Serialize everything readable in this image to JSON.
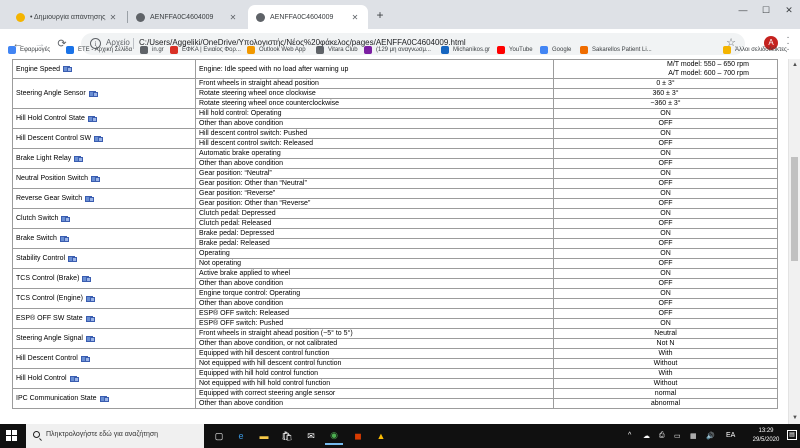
{
  "browser": {
    "tabs": [
      {
        "title": "• Δημιουργία απάντησης",
        "favicon_color": "#f4b400",
        "active": false
      },
      {
        "title": "AENFFA0C4604009",
        "favicon_color": "#5f6368",
        "active": false
      },
      {
        "title": "AENFFA0C4604009",
        "favicon_color": "#5f6368",
        "active": true
      }
    ],
    "new_tab_glyph": "+",
    "window_controls": {
      "minimize": "—",
      "maximize": "☐",
      "close": "✕"
    },
    "nav": {
      "back": "←",
      "forward": "→",
      "reload": "⟳"
    },
    "omnibox": {
      "scheme_label": "Αρχείο",
      "url": "C:/Users/Aggeliki/OneDrive/Υπολογιστής/Νέος%20φάκελος/pages/AENFFA0C4604009.html"
    },
    "profile_initial": "A",
    "bookmarks": [
      {
        "label": "Εφαρμογές",
        "icon_color": "#4285f4"
      },
      {
        "label": "ΕΤΕ - Αρχική Σελίδα",
        "icon_color": "#1a73e8"
      },
      {
        "label": "in.gr",
        "icon_color": "#5f6368"
      },
      {
        "label": "ΕΦΚΑ | Ενιαίος Φορ...",
        "icon_color": "#d93025"
      },
      {
        "label": "Outlook Web App",
        "icon_color": "#f29900"
      },
      {
        "label": "Vitara Club",
        "icon_color": "#5f6368"
      },
      {
        "label": "(129 μη αναγνωσμ...",
        "icon_color": "#7b1fa2"
      },
      {
        "label": "Michanikos.gr",
        "icon_color": "#1565c0"
      },
      {
        "label": "YouTube",
        "icon_color": "#ff0000"
      },
      {
        "label": "Google",
        "icon_color": "#4285f4"
      },
      {
        "label": "Sakarellos Patient Li...",
        "icon_color": "#ef6c00"
      }
    ],
    "other_bookmarks": "Άλλοι σελιδοδείκτες"
  },
  "spec_table": [
    {
      "item": "Engine Speed",
      "conditions": [
        {
          "condition": "Engine: Idle speed with no load after warning up",
          "value": "M/T model: 550 – 650 rpm\nA/T model: 600 – 700 rpm"
        }
      ]
    },
    {
      "item": "Steering Angle Sensor",
      "conditions": [
        {
          "condition": "Front wheels in straight ahead position",
          "value": "0 ± 3°"
        },
        {
          "condition": "Rotate steering wheel once clockwise",
          "value": "360 ± 3°"
        },
        {
          "condition": "Rotate steering wheel once counterclockwise",
          "value": "−360 ± 3°"
        }
      ]
    },
    {
      "item": "Hill Hold Control State",
      "conditions": [
        {
          "condition": "Hill hold control: Operating",
          "value": "ON"
        },
        {
          "condition": "Other than above condition",
          "value": "OFF"
        }
      ]
    },
    {
      "item": "Hill Descent Control SW",
      "conditions": [
        {
          "condition": "Hill descent control switch: Pushed",
          "value": "ON"
        },
        {
          "condition": "Hill descent control switch: Released",
          "value": "OFF"
        }
      ]
    },
    {
      "item": "Brake Light Relay",
      "conditions": [
        {
          "condition": "Automatic brake operating",
          "value": "ON"
        },
        {
          "condition": "Other than above condition",
          "value": "OFF"
        }
      ]
    },
    {
      "item": "Neutral Position Switch",
      "conditions": [
        {
          "condition": "Gear position: “Neutral”",
          "value": "ON"
        },
        {
          "condition": "Gear position: Other than “Neutral”",
          "value": "OFF"
        }
      ]
    },
    {
      "item": "Reverse Gear Switch",
      "conditions": [
        {
          "condition": "Gear position: “Reverse”",
          "value": "ON"
        },
        {
          "condition": "Gear position: Other than “Reverse”",
          "value": "OFF"
        }
      ]
    },
    {
      "item": "Clutch Switch",
      "conditions": [
        {
          "condition": "Clutch pedal: Depressed",
          "value": "ON"
        },
        {
          "condition": "Clutch pedal: Released",
          "value": "OFF"
        }
      ]
    },
    {
      "item": "Brake Switch",
      "conditions": [
        {
          "condition": "Brake pedal: Depressed",
          "value": "ON"
        },
        {
          "condition": "Brake pedal: Released",
          "value": "OFF"
        }
      ]
    },
    {
      "item": "Stability Control",
      "conditions": [
        {
          "condition": "Operating",
          "value": "ON"
        },
        {
          "condition": "Not operating",
          "value": "OFF"
        }
      ]
    },
    {
      "item": "TCS Control (Brake)",
      "conditions": [
        {
          "condition": "Active brake applied to wheel",
          "value": "ON"
        },
        {
          "condition": "Other than above condition",
          "value": "OFF"
        }
      ]
    },
    {
      "item": "TCS Control (Engine)",
      "conditions": [
        {
          "condition": "Engine torque control: Operating",
          "value": "ON"
        },
        {
          "condition": "Other than above condition",
          "value": "OFF"
        }
      ]
    },
    {
      "item": "ESP® OFF SW State",
      "conditions": [
        {
          "condition": "ESP® OFF switch: Released",
          "value": "OFF"
        },
        {
          "condition": "ESP® OFF switch: Pushed",
          "value": "ON"
        }
      ]
    },
    {
      "item": "Steering Angle Signal",
      "conditions": [
        {
          "condition": "Front wheels in straight ahead position (−5° to 5°)",
          "value": "Neutral"
        },
        {
          "condition": "Other than above condition, or not calibrated",
          "value": "Not N"
        }
      ]
    },
    {
      "item": "Hill Descent Control",
      "conditions": [
        {
          "condition": "Equipped with hill descent control function",
          "value": "With"
        },
        {
          "condition": "Not equipped with hill descent control function",
          "value": "Without"
        }
      ]
    },
    {
      "item": "Hill Hold Control",
      "conditions": [
        {
          "condition": "Equipped with hill hold control function",
          "value": "With"
        },
        {
          "condition": "Not equipped with hill hold control function",
          "value": "Without"
        }
      ]
    },
    {
      "item": "IPC Communication State",
      "conditions": [
        {
          "condition": "Equipped with correct steering angle sensor",
          "value": "normal"
        },
        {
          "condition": "Other than above condition",
          "value": "abnormal"
        }
      ]
    }
  ],
  "taskbar": {
    "search_placeholder": "Πληκτρολογήστε εδώ για αναζήτηση",
    "apps": [
      {
        "name": "task-view",
        "glyph": "▢",
        "color": "#ffffff"
      },
      {
        "name": "edge",
        "glyph": "e",
        "color": "#3a96dd"
      },
      {
        "name": "file-explorer",
        "glyph": "▬",
        "color": "#f7c948"
      },
      {
        "name": "store",
        "glyph": "🛍",
        "color": "#ffffff"
      },
      {
        "name": "mail",
        "glyph": "✉",
        "color": "#ffffff"
      },
      {
        "name": "chrome",
        "glyph": "◉",
        "color": "#4caf50"
      },
      {
        "name": "office",
        "glyph": "◼",
        "color": "#d83b01"
      },
      {
        "name": "drive",
        "glyph": "▲",
        "color": "#fbbc04"
      }
    ],
    "tray": {
      "chevron": "^",
      "language": "EA"
    },
    "clock": {
      "time": "13:29",
      "date": "29/5/2020"
    }
  }
}
